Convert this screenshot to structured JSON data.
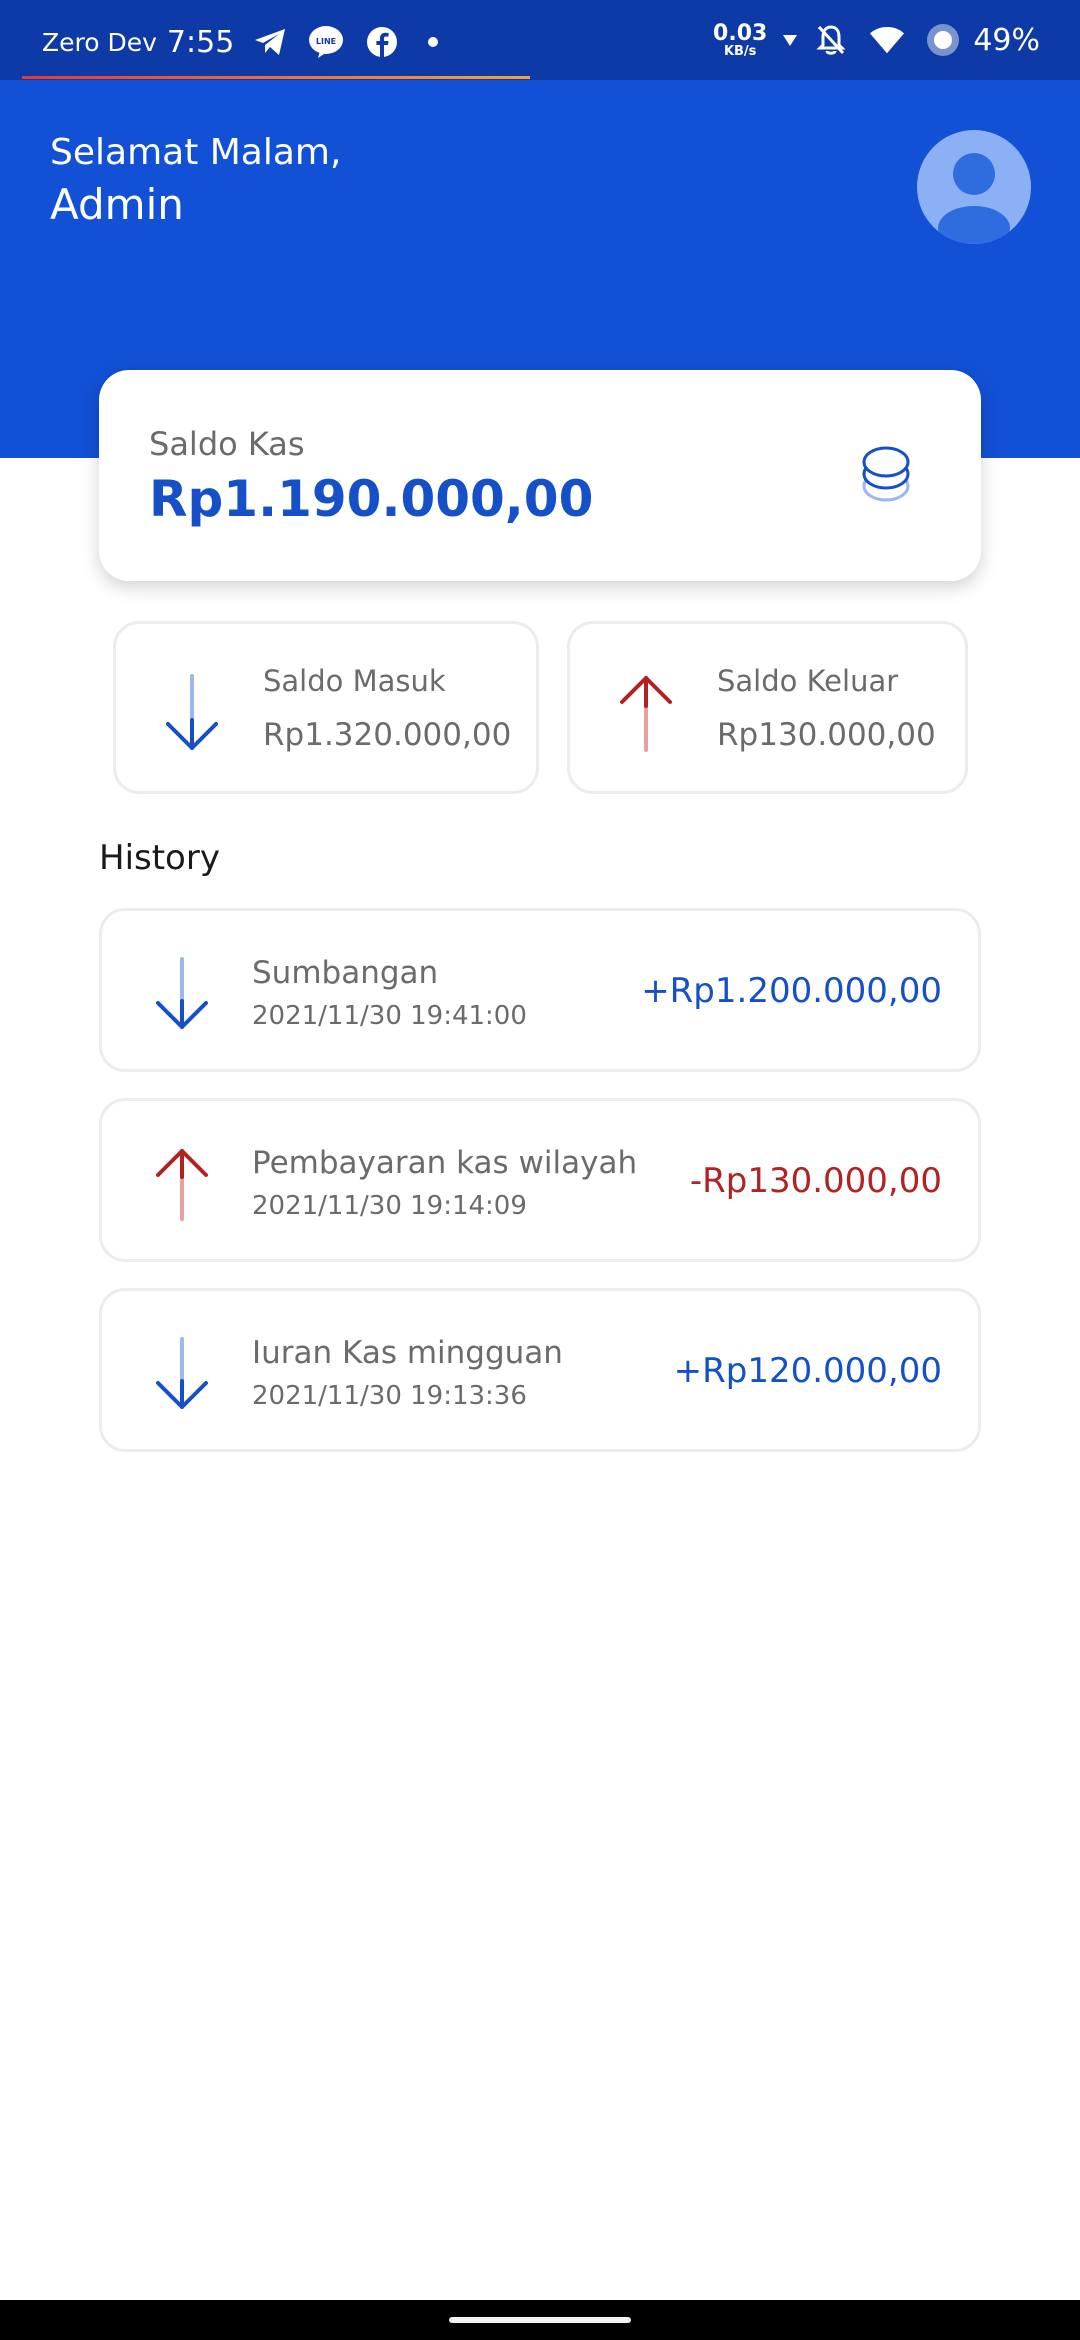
{
  "status_bar": {
    "carrier": "Zero Dev",
    "time": "7:55",
    "net_speed_value": "0.03",
    "net_speed_unit": "KB/s",
    "battery": "49%",
    "icons": [
      "telegram-icon",
      "line-icon",
      "facebook-icon",
      "dot-icon",
      "download-arrow-icon",
      "mute-bell-icon",
      "wifi-icon",
      "battery-icon"
    ]
  },
  "header": {
    "greeting": "Selamat Malam,",
    "username": "Admin",
    "avatar_icon": "user-avatar-icon"
  },
  "balance": {
    "label": "Saldo Kas",
    "value": "Rp1.190.000,00",
    "icon": "coins-icon"
  },
  "summary": {
    "income": {
      "label": "Saldo Masuk",
      "value": "Rp1.320.000,00",
      "icon": "arrow-down-icon"
    },
    "expense": {
      "label": "Saldo Keluar",
      "value": "Rp130.000,00",
      "icon": "arrow-up-icon"
    }
  },
  "history": {
    "title": "History",
    "items": [
      {
        "title": "Sumbangan",
        "date": "2021/11/30 19:41:00",
        "amount": "+Rp1.200.000,00",
        "direction": "in"
      },
      {
        "title": "Pembayaran kas wilayah",
        "date": "2021/11/30 19:14:09",
        "amount": "-Rp130.000,00",
        "direction": "out"
      },
      {
        "title": "Iuran Kas mingguan",
        "date": "2021/11/30 19:13:36",
        "amount": "+Rp120.000,00",
        "direction": "in"
      }
    ]
  },
  "colors": {
    "primary": "#1250d6",
    "status_bar": "#0d3aa6",
    "income": "#1550c9",
    "expense": "#b32222",
    "muted_text": "#6b6b6b"
  }
}
